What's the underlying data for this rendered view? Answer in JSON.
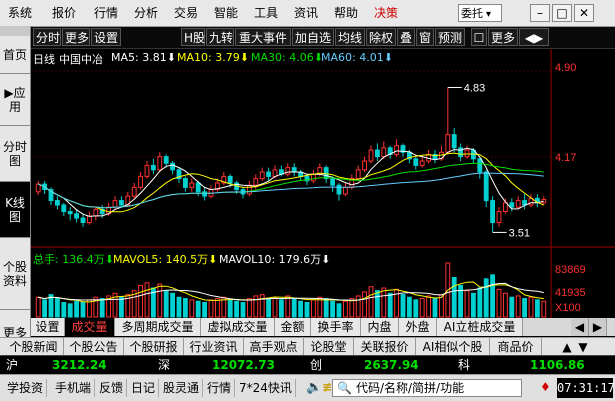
{
  "menu": {
    "items": [
      "系统",
      "报价",
      "行情",
      "分析",
      "交易",
      "智能",
      "工具",
      "资讯",
      "帮助",
      "决策"
    ],
    "consign_label": "委托",
    "consign_arrow": "▾",
    "win_buttons": [
      "–",
      "□",
      "✕"
    ]
  },
  "leftnav": {
    "items": [
      {
        "label": "首页",
        "active": false
      },
      {
        "label": "▶应用",
        "active": false
      },
      {
        "label": "分时图",
        "active": false
      },
      {
        "label": "K线图",
        "active": true
      },
      {
        "label": "个股资料",
        "active": false
      },
      {
        "label": "更多",
        "active": false
      }
    ]
  },
  "toolbar": {
    "left": [
      "分时",
      "更多",
      "设置"
    ],
    "right": [
      "H股",
      "九转",
      "重大事件",
      "加自选",
      "均线",
      "除权",
      "叠",
      "窗",
      "预测",
      "更多",
      "◀▶"
    ]
  },
  "chart_data": {
    "type": "candlestick",
    "period": "日线",
    "stock_name": "中国中冶",
    "ma_legend": [
      {
        "name": "MA5",
        "value": "3.81",
        "arrow": "⬇",
        "color": "#ffffff"
      },
      {
        "name": "MA10",
        "value": "3.79",
        "arrow": "⬇",
        "color": "#ffff00"
      },
      {
        "name": "MA30",
        "value": "4.06",
        "arrow": "⬇",
        "color": "#00e000"
      },
      {
        "name": "MA60",
        "value": "4.01",
        "arrow": "⬇",
        "color": "#66ccff"
      }
    ],
    "price_axis": {
      "top": "4.90",
      "mid": "4.17",
      "ymin": 3.45,
      "ymax": 4.98
    },
    "high_mark": "4.83",
    "low_mark": "3.51",
    "candles": [
      [
        3.88,
        3.95,
        3.98,
        3.85
      ],
      [
        3.95,
        3.9,
        3.98,
        3.86
      ],
      [
        3.9,
        3.8,
        3.92,
        3.76
      ],
      [
        3.8,
        3.76,
        3.84,
        3.72
      ],
      [
        3.76,
        3.7,
        3.78,
        3.66
      ],
      [
        3.7,
        3.68,
        3.74,
        3.62
      ],
      [
        3.68,
        3.64,
        3.72,
        3.6
      ],
      [
        3.64,
        3.6,
        3.68,
        3.56
      ],
      [
        3.6,
        3.66,
        3.7,
        3.58
      ],
      [
        3.66,
        3.72,
        3.74,
        3.62
      ],
      [
        3.72,
        3.68,
        3.76,
        3.64
      ],
      [
        3.68,
        3.74,
        3.78,
        3.66
      ],
      [
        3.74,
        3.8,
        3.84,
        3.72
      ],
      [
        3.8,
        3.76,
        3.84,
        3.74
      ],
      [
        3.76,
        3.84,
        3.88,
        3.74
      ],
      [
        3.84,
        3.92,
        3.96,
        3.82
      ],
      [
        3.92,
        4.02,
        4.06,
        3.9
      ],
      [
        4.02,
        4.12,
        4.16,
        4.0
      ],
      [
        4.12,
        4.08,
        4.18,
        4.04
      ],
      [
        4.08,
        4.2,
        4.24,
        4.06
      ],
      [
        4.2,
        4.14,
        4.22,
        4.1
      ],
      [
        4.14,
        4.08,
        4.16,
        4.04
      ],
      [
        4.08,
        4.0,
        4.1,
        3.96
      ],
      [
        4.0,
        3.92,
        4.02,
        3.88
      ],
      [
        3.92,
        3.96,
        4.0,
        3.88
      ],
      [
        3.96,
        3.88,
        3.98,
        3.84
      ],
      [
        3.88,
        3.84,
        3.92,
        3.8
      ],
      [
        3.84,
        3.9,
        3.94,
        3.82
      ],
      [
        3.9,
        3.96,
        4.0,
        3.88
      ],
      [
        3.96,
        4.02,
        4.06,
        3.94
      ],
      [
        4.02,
        3.96,
        4.04,
        3.92
      ],
      [
        3.96,
        3.9,
        3.98,
        3.86
      ],
      [
        3.9,
        3.86,
        3.92,
        3.82
      ],
      [
        3.86,
        3.94,
        3.98,
        3.84
      ],
      [
        3.94,
        4.0,
        4.04,
        3.9
      ],
      [
        4.0,
        4.06,
        4.1,
        3.98
      ],
      [
        4.06,
        4.02,
        4.1,
        3.98
      ],
      [
        4.02,
        4.08,
        4.12,
        4.0
      ],
      [
        4.08,
        4.04,
        4.12,
        4.02
      ],
      [
        4.04,
        4.1,
        4.14,
        4.02
      ],
      [
        4.1,
        4.06,
        4.14,
        4.02
      ],
      [
        4.06,
        4.02,
        4.08,
        3.98
      ],
      [
        4.02,
        3.98,
        4.04,
        3.94
      ],
      [
        3.98,
        4.04,
        4.08,
        3.96
      ],
      [
        4.04,
        4.1,
        4.14,
        4.02
      ],
      [
        4.1,
        4.0,
        4.12,
        3.96
      ],
      [
        4.0,
        3.94,
        4.02,
        3.88
      ],
      [
        3.94,
        3.86,
        3.96,
        3.8
      ],
      [
        3.86,
        3.92,
        3.96,
        3.84
      ],
      [
        3.92,
        4.0,
        4.04,
        3.9
      ],
      [
        4.0,
        4.08,
        4.12,
        3.98
      ],
      [
        4.08,
        4.16,
        4.2,
        4.06
      ],
      [
        4.16,
        4.26,
        4.3,
        4.14
      ],
      [
        4.26,
        4.2,
        4.32,
        4.16
      ],
      [
        4.2,
        4.28,
        4.34,
        4.18
      ],
      [
        4.28,
        4.22,
        4.3,
        4.18
      ],
      [
        4.22,
        4.3,
        4.36,
        4.2
      ],
      [
        4.3,
        4.24,
        4.32,
        4.2
      ],
      [
        4.24,
        4.18,
        4.26,
        4.14
      ],
      [
        4.18,
        4.12,
        4.2,
        4.08
      ],
      [
        4.12,
        4.16,
        4.2,
        4.1
      ],
      [
        4.16,
        4.22,
        4.26,
        4.14
      ],
      [
        4.22,
        4.18,
        4.26,
        4.14
      ],
      [
        4.18,
        4.24,
        4.3,
        4.16
      ],
      [
        4.24,
        4.4,
        4.83,
        4.22
      ],
      [
        4.4,
        4.28,
        4.46,
        4.24
      ],
      [
        4.28,
        4.2,
        4.32,
        4.16
      ],
      [
        4.2,
        4.26,
        4.3,
        4.18
      ],
      [
        4.26,
        4.18,
        4.28,
        4.14
      ],
      [
        4.18,
        4.06,
        4.2,
        4.0
      ],
      [
        4.06,
        3.8,
        4.08,
        3.74
      ],
      [
        3.8,
        3.6,
        3.84,
        3.51
      ],
      [
        3.6,
        3.7,
        3.74,
        3.56
      ],
      [
        3.7,
        3.78,
        3.82,
        3.68
      ],
      [
        3.78,
        3.74,
        3.82,
        3.7
      ],
      [
        3.74,
        3.8,
        3.84,
        3.72
      ],
      [
        3.8,
        3.76,
        3.86,
        3.72
      ],
      [
        3.76,
        3.82,
        3.86,
        3.74
      ],
      [
        3.82,
        3.78,
        3.86,
        3.74
      ],
      [
        3.78,
        3.81,
        3.84,
        3.76
      ]
    ],
    "volume_legend": [
      {
        "name": "总手",
        "value": "136.4万",
        "arrow": "⬇",
        "color": "#00e000"
      },
      {
        "name": "MAVOL5",
        "value": "140.5万",
        "arrow": "⬇",
        "color": "#ffff00"
      },
      {
        "name": "MAVOL10",
        "value": "179.6万",
        "arrow": "⬇",
        "color": "#ffffff"
      }
    ],
    "volume_axis": {
      "top": "83869",
      "mid": "41935",
      "unit": "X100",
      "vmax": 83869
    },
    "volumes": [
      30,
      26,
      34,
      28,
      22,
      20,
      24,
      22,
      26,
      30,
      28,
      32,
      36,
      30,
      34,
      40,
      48,
      52,
      44,
      50,
      40,
      36,
      30,
      28,
      26,
      24,
      22,
      26,
      28,
      30,
      26,
      24,
      22,
      28,
      32,
      34,
      28,
      30,
      26,
      32,
      28,
      24,
      22,
      26,
      30,
      28,
      24,
      20,
      24,
      28,
      32,
      38,
      46,
      40,
      44,
      36,
      42,
      34,
      30,
      26,
      28,
      32,
      28,
      34,
      82,
      60,
      48,
      40,
      36,
      44,
      58,
      64,
      42,
      36,
      30,
      32,
      28,
      30,
      26,
      24
    ]
  },
  "subtabs": [
    "设置",
    "成交量",
    "多周期成交量",
    "虚拟成交量",
    "金额",
    "换手率",
    "内盘",
    "外盘",
    "AI立桩成交量"
  ],
  "subtab_active": 1,
  "newsbar": [
    "个股新闻",
    "个股公告",
    "个股研报",
    "行业资讯",
    "高手观点",
    "论股堂",
    "关联报价",
    "AI相似个股",
    "商品价"
  ],
  "indexbar": [
    {
      "label": "沪",
      "value": "3212.24"
    },
    {
      "label": "深",
      "value": "12072.73"
    },
    {
      "label": "创",
      "value": "2637.94"
    },
    {
      "label": "科",
      "value": "1106.86"
    }
  ],
  "statusbar": {
    "items": [
      "学投资",
      "手机端",
      "反馈",
      "日记",
      "股灵通",
      "行情",
      "7*24快讯"
    ],
    "input_placeholder": "代码/名称/简拼/功能",
    "clock": "07:31:17"
  },
  "colors": {
    "up": "#ff3030",
    "down": "#00d0d0",
    "ma5": "#ffffff",
    "ma10": "#ffff00",
    "ma30": "#00e000",
    "ma60": "#66ccff"
  }
}
